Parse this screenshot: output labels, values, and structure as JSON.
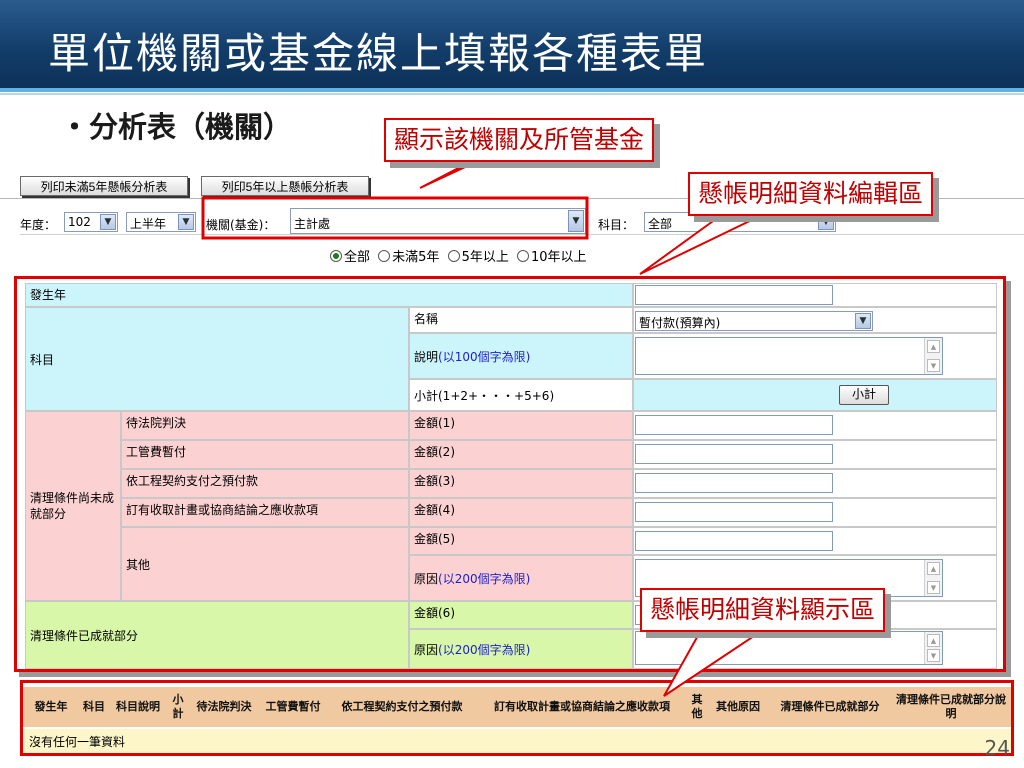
{
  "slide": {
    "title": "單位機關或基金線上填報各種表單",
    "bullet": "・分析表（機關）",
    "page_number": "24"
  },
  "callouts": {
    "fund": "顯示該機關及所管基金",
    "edit": "懸帳明細資料編輯區",
    "show": "懸帳明細資料顯示區"
  },
  "toolbar": {
    "print_under5": "列印未滿5年懸帳分析表",
    "print_over5": "列印5年以上懸帳分析表"
  },
  "filters": {
    "year_label": "年度：",
    "year_value": "102",
    "half_value": "上半年",
    "agency_label": "機關(基金)：",
    "agency_value": "主計處",
    "subject_label": "科目：",
    "subject_value": "全部"
  },
  "radios": {
    "all": "全部",
    "under5": "未滿5年",
    "over5": "5年以上",
    "over10": "10年以上"
  },
  "form": {
    "year_occurred": "發生年",
    "subject": "科目",
    "name_label": "名稱",
    "name_value": "暫付款(預算內)",
    "desc_label": "說明",
    "desc_hint": "(以100個字為限)",
    "subtotal_label": "小計(1+2+・・・+5+6)",
    "subtotal_button": "小計",
    "pending_group": "清理條件尚未成就部分",
    "items": [
      {
        "label": "待法院判決",
        "amount": "金額(1)"
      },
      {
        "label": "工管費暫付",
        "amount": "金額(2)"
      },
      {
        "label": "依工程契約支付之預付款",
        "amount": "金額(3)"
      },
      {
        "label": "訂有收取計畫或協商結論之應收款項",
        "amount": "金額(4)"
      }
    ],
    "other_label": "其他",
    "amount5": "金額(5)",
    "reason_label": "原因",
    "reason_hint": "(以200個字為限)",
    "done_group": "清理條件已成就部分",
    "amount6": "金額(6)"
  },
  "list": {
    "headers": [
      "發生年",
      "科目",
      "科目說明",
      "小計",
      "待法院判決",
      "工管費暫付",
      "依工程契約支付之預付款",
      "訂有收取計畫或協商結論之應收款項",
      "其他",
      "其他原因",
      "清理條件已成就部分",
      "清理條件已成就部分說明"
    ],
    "empty": "沒有任何一筆資料"
  }
}
